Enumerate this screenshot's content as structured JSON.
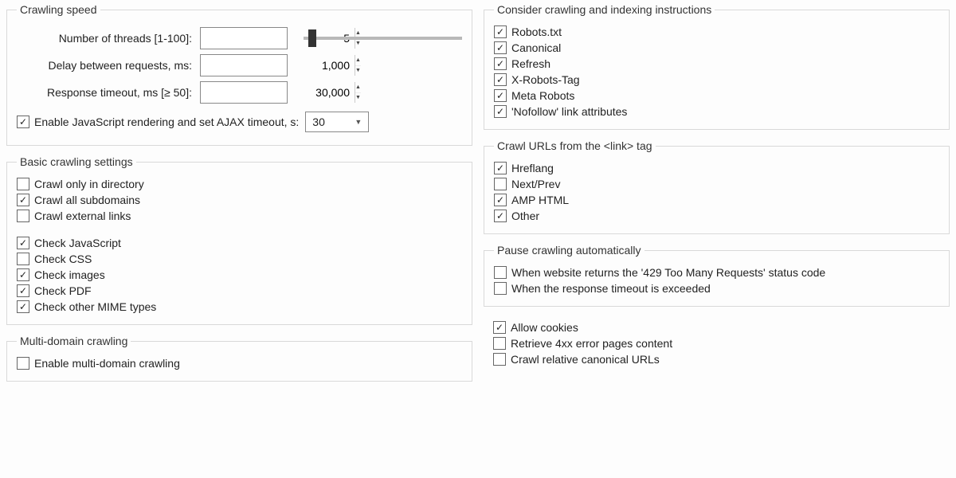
{
  "crawl_speed": {
    "legend": "Crawling speed",
    "threads_label": "Number of threads [1-100]:",
    "threads_value": "5",
    "delay_label": "Delay between requests, ms:",
    "delay_value": "1,000",
    "timeout_label": "Response timeout, ms [≥ 50]:",
    "timeout_value": "30,000",
    "js_render_label": "Enable JavaScript rendering and set AJAX timeout, s:",
    "js_render_checked": true,
    "js_render_dropdown": "30"
  },
  "basic": {
    "legend": "Basic crawling settings",
    "items_a": [
      {
        "label": "Crawl only in directory",
        "checked": false
      },
      {
        "label": "Crawl all subdomains",
        "checked": true
      },
      {
        "label": "Crawl external links",
        "checked": false
      }
    ],
    "items_b": [
      {
        "label": "Check JavaScript",
        "checked": true
      },
      {
        "label": "Check CSS",
        "checked": false
      },
      {
        "label": "Check images",
        "checked": true
      },
      {
        "label": "Check PDF",
        "checked": true
      },
      {
        "label": "Check other MIME types",
        "checked": true
      }
    ]
  },
  "multi": {
    "legend": "Multi-domain crawling",
    "enable_label": "Enable multi-domain crawling",
    "enable_checked": false
  },
  "consider": {
    "legend": "Consider crawling and indexing instructions",
    "items": [
      {
        "label": "Robots.txt",
        "checked": true
      },
      {
        "label": "Canonical",
        "checked": true
      },
      {
        "label": "Refresh",
        "checked": true
      },
      {
        "label": "X-Robots-Tag",
        "checked": true
      },
      {
        "label": "Meta Robots",
        "checked": true
      },
      {
        "label": "'Nofollow' link attributes",
        "checked": true
      }
    ]
  },
  "linktag": {
    "legend": "Crawl URLs from the <link> tag",
    "items": [
      {
        "label": "Hreflang",
        "checked": true
      },
      {
        "label": "Next/Prev",
        "checked": false
      },
      {
        "label": "AMP HTML",
        "checked": true
      },
      {
        "label": "Other",
        "checked": true
      }
    ]
  },
  "pause": {
    "legend": "Pause crawling automatically",
    "items": [
      {
        "label": "When website returns the '429 Too Many Requests' status code",
        "checked": false
      },
      {
        "label": "When the response timeout is exceeded",
        "checked": false
      }
    ]
  },
  "loose": {
    "items": [
      {
        "label": "Allow cookies",
        "checked": true
      },
      {
        "label": "Retrieve 4xx error pages content",
        "checked": false
      },
      {
        "label": "Crawl relative canonical URLs",
        "checked": false
      }
    ]
  }
}
